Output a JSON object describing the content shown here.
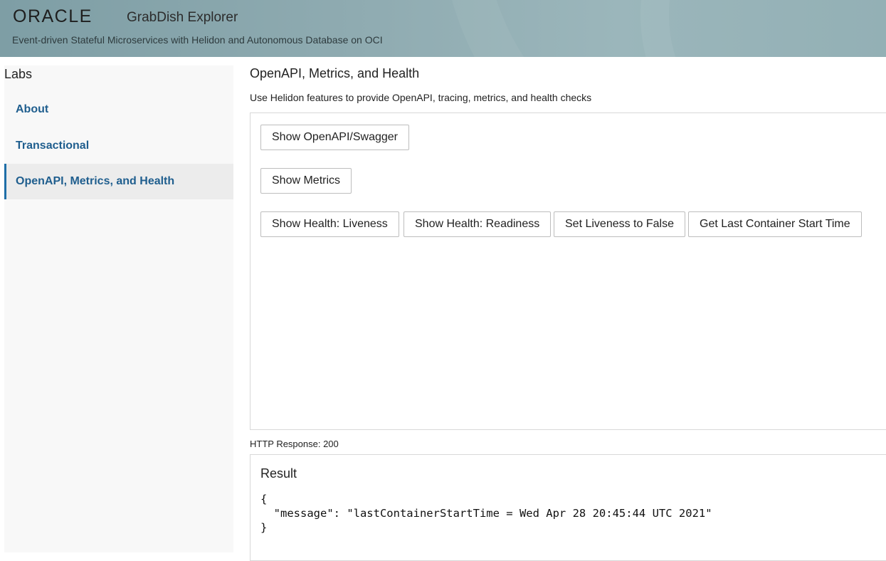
{
  "header": {
    "logo_text": "ORACLE",
    "app_title": "GrabDish Explorer",
    "subtitle": "Event-driven Stateful Microservices with Helidon and Autonomous Database on OCI",
    "background_color": "#8fabb1"
  },
  "sidebar": {
    "heading": "Labs",
    "items": [
      {
        "label": "About",
        "active": false
      },
      {
        "label": "Transactional",
        "active": false
      },
      {
        "label": "OpenAPI, Metrics, and Health",
        "active": true
      }
    ],
    "link_color": "#1f5e8e",
    "active_accent": "#1f6fa8"
  },
  "main": {
    "title": "OpenAPI, Metrics, and Health",
    "description": "Use Helidon features to provide OpenAPI, tracing, metrics, and health checks",
    "buttons": {
      "show_openapi": "Show OpenAPI/Swagger",
      "show_metrics": "Show Metrics",
      "health_liveness": "Show Health: Liveness",
      "health_readiness": "Show Health: Readiness",
      "set_liveness_false": "Set Liveness to False",
      "last_container_start": "Get Last Container Start Time"
    }
  },
  "response": {
    "status_text": "HTTP Response: 200",
    "result_title": "Result",
    "result_body": "{\n  \"message\": \"lastContainerStartTime = Wed Apr 28 20:45:44 UTC 2021\"\n}"
  }
}
